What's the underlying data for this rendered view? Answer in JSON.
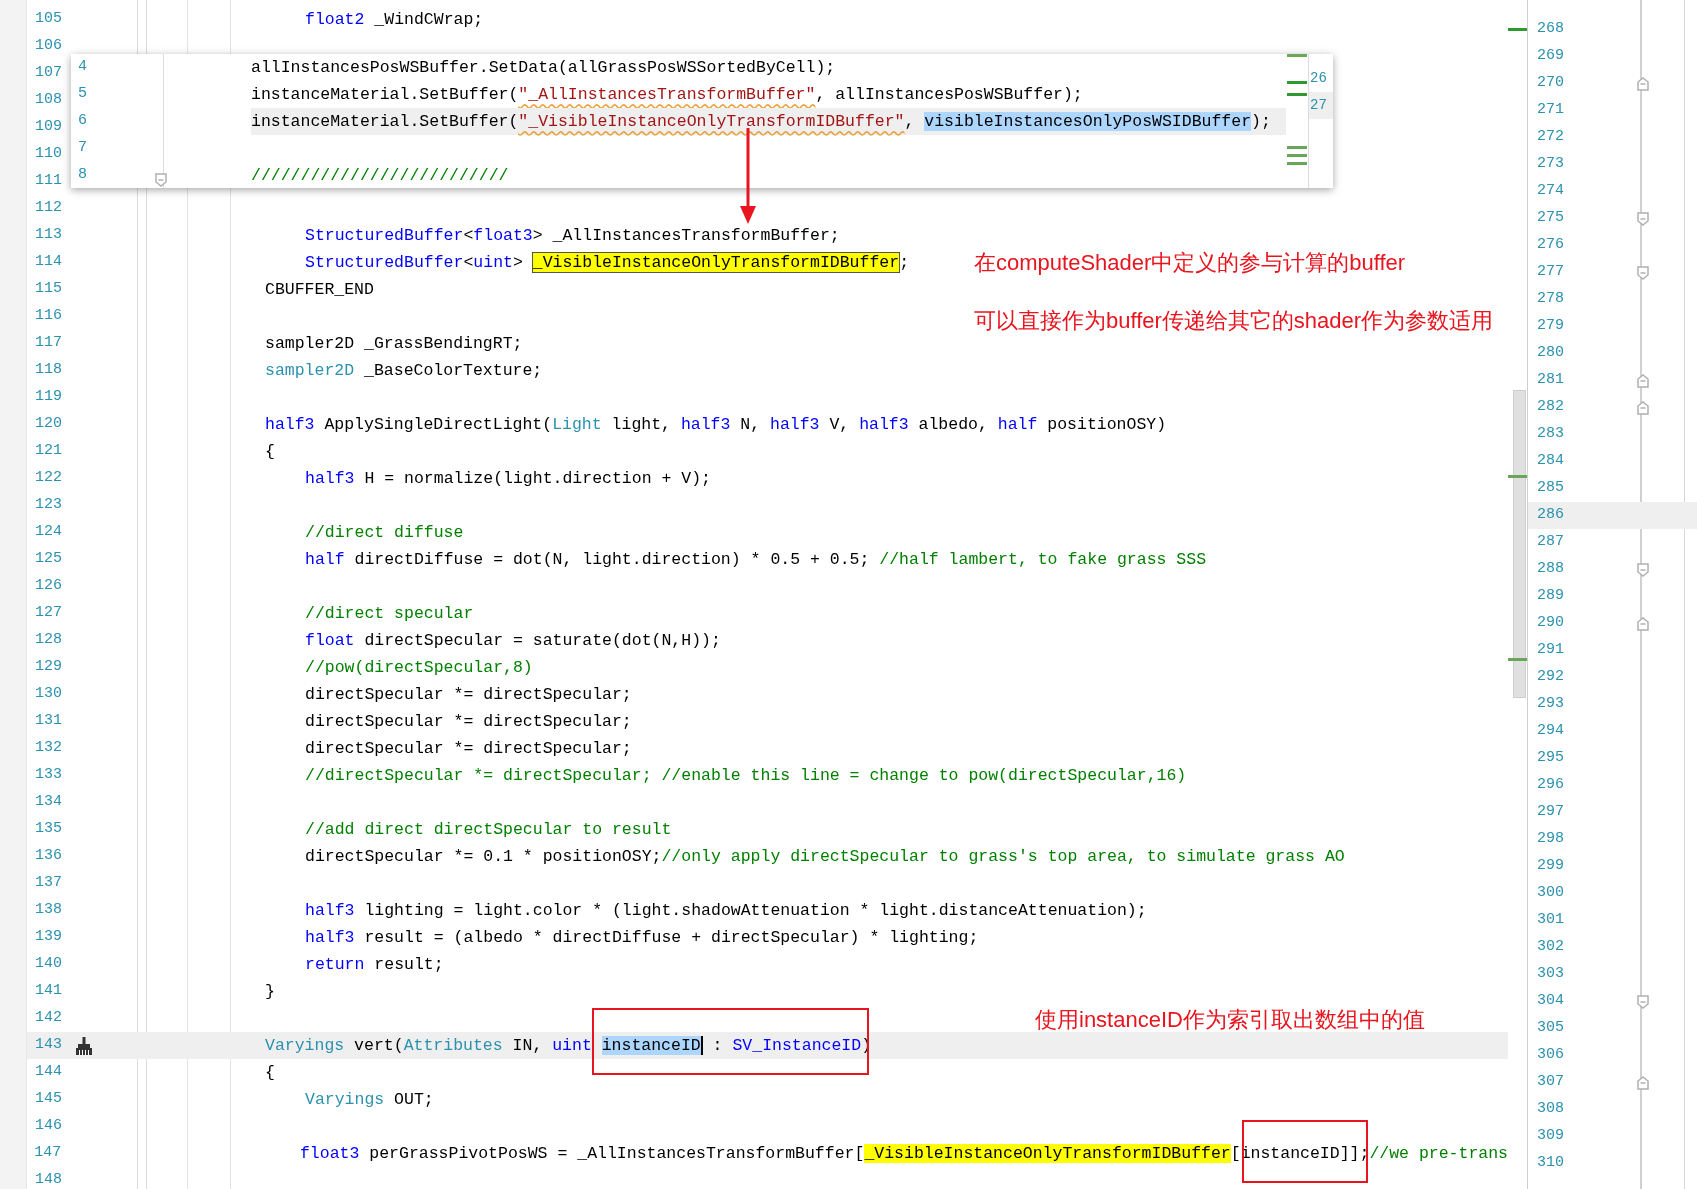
{
  "left_editor": {
    "lines": [
      {
        "number": "105",
        "current": false,
        "indented": true,
        "tokens": [
          {
            "kind": "keyword",
            "text": "float2"
          },
          {
            "kind": "plain",
            "text": " _WindCWrap;"
          }
        ]
      },
      {
        "number": "106",
        "current": false
      },
      {
        "number": "107",
        "current": false
      },
      {
        "number": "108",
        "current": false
      },
      {
        "number": "109",
        "current": false
      },
      {
        "number": "110",
        "current": false
      },
      {
        "number": "111",
        "current": false
      },
      {
        "number": "112",
        "current": false
      },
      {
        "number": "113",
        "current": false,
        "indented": true,
        "tokens": [
          {
            "kind": "keyword",
            "text": "StructuredBuffer"
          },
          {
            "kind": "plain",
            "text": "<"
          },
          {
            "kind": "keyword",
            "text": "float3"
          },
          {
            "kind": "plain",
            "text": "> _AllInstancesTransformBuffer;"
          }
        ]
      },
      {
        "number": "114",
        "current": false,
        "indented": true,
        "tokens": [
          {
            "kind": "keyword",
            "text": "StructuredBuffer"
          },
          {
            "kind": "plain",
            "text": "<"
          },
          {
            "kind": "keyword",
            "text": "uint"
          },
          {
            "kind": "plain",
            "text": ">"
          },
          {
            "kind": "highlight-outlined",
            "space_before": true,
            "text": "_VisibleInstanceOnlyTransformIDBuffer"
          },
          {
            "kind": "plain",
            "text": ";"
          }
        ]
      },
      {
        "number": "115",
        "current": false,
        "indented": false,
        "tokens": [
          {
            "kind": "plain",
            "text": "CBUFFER_END"
          }
        ]
      },
      {
        "number": "116",
        "current": false
      },
      {
        "number": "117",
        "current": false,
        "indented": false,
        "tokens": [
          {
            "kind": "plain",
            "text": "sampler2D _GrassBendingRT;"
          }
        ]
      },
      {
        "number": "118",
        "current": false,
        "indented": false,
        "tokens": [
          {
            "kind": "type",
            "text": "sampler2D"
          },
          {
            "kind": "plain",
            "text": " _BaseColorTexture;"
          }
        ]
      },
      {
        "number": "119",
        "current": false
      },
      {
        "number": "120",
        "current": false,
        "indented": false,
        "tokens": [
          {
            "kind": "keyword",
            "text": "half3"
          },
          {
            "kind": "plain",
            "text": " ApplySingleDirectLight("
          },
          {
            "kind": "type",
            "text": "Light"
          },
          {
            "kind": "plain",
            "text": " light, "
          },
          {
            "kind": "keyword",
            "text": "half3"
          },
          {
            "kind": "plain",
            "text": " N, "
          },
          {
            "kind": "keyword",
            "text": "half3"
          },
          {
            "kind": "plain",
            "text": " V, "
          },
          {
            "kind": "keyword",
            "text": "half3"
          },
          {
            "kind": "plain",
            "text": " albedo, "
          },
          {
            "kind": "keyword",
            "text": "half"
          },
          {
            "kind": "plain",
            "text": " positionOSY)"
          }
        ]
      },
      {
        "number": "121",
        "current": false,
        "indented": false,
        "tokens": [
          {
            "kind": "plain",
            "text": "{"
          }
        ]
      },
      {
        "number": "122",
        "current": false,
        "indented": true,
        "tokens": [
          {
            "kind": "keyword",
            "text": "half3"
          },
          {
            "kind": "plain",
            "text": " H = normalize(light.direction + V);"
          }
        ]
      },
      {
        "number": "123",
        "current": false
      },
      {
        "number": "124",
        "current": false,
        "indented": true,
        "tokens": [
          {
            "kind": "comment",
            "text": "//direct diffuse"
          }
        ]
      },
      {
        "number": "125",
        "current": false,
        "indented": true,
        "tokens": [
          {
            "kind": "keyword",
            "text": "half"
          },
          {
            "kind": "plain",
            "text": " directDiffuse = dot(N, light.direction) * 0.5 + 0.5; "
          },
          {
            "kind": "comment",
            "text": "//half lambert, to fake grass SSS"
          }
        ]
      },
      {
        "number": "126",
        "current": false
      },
      {
        "number": "127",
        "current": false,
        "indented": true,
        "tokens": [
          {
            "kind": "comment",
            "text": "//direct specular"
          }
        ]
      },
      {
        "number": "128",
        "current": false,
        "indented": true,
        "tokens": [
          {
            "kind": "keyword",
            "text": "float"
          },
          {
            "kind": "plain",
            "text": " directSpecular = saturate(dot(N,H));"
          }
        ]
      },
      {
        "number": "129",
        "current": false,
        "indented": true,
        "tokens": [
          {
            "kind": "comment",
            "text": "//pow(directSpecular,8)"
          }
        ]
      },
      {
        "number": "130",
        "current": false,
        "indented": true,
        "tokens": [
          {
            "kind": "plain",
            "text": "directSpecular *= directSpecular;"
          }
        ]
      },
      {
        "number": "131",
        "current": false,
        "indented": true,
        "tokens": [
          {
            "kind": "plain",
            "text": "directSpecular *= directSpecular;"
          }
        ]
      },
      {
        "number": "132",
        "current": false,
        "indented": true,
        "tokens": [
          {
            "kind": "plain",
            "text": "directSpecular *= directSpecular;"
          }
        ]
      },
      {
        "number": "133",
        "current": false,
        "indented": true,
        "tokens": [
          {
            "kind": "comment",
            "text": "//directSpecular *= directSpecular; //enable this line = change to pow(directSpecular,16)"
          }
        ]
      },
      {
        "number": "134",
        "current": false
      },
      {
        "number": "135",
        "current": false,
        "indented": true,
        "tokens": [
          {
            "kind": "comment",
            "text": "//add direct directSpecular to result"
          }
        ]
      },
      {
        "number": "136",
        "current": false,
        "indented": true,
        "tokens": [
          {
            "kind": "plain",
            "text": "directSpecular *= 0.1 * positionOSY;"
          },
          {
            "kind": "comment",
            "text": "//only apply directSpecular to grass's top area, to simulate grass AO"
          }
        ]
      },
      {
        "number": "137",
        "current": false
      },
      {
        "number": "138",
        "current": false,
        "indented": true,
        "tokens": [
          {
            "kind": "keyword",
            "text": "half3"
          },
          {
            "kind": "plain",
            "text": " lighting = light.color * (light.shadowAttenuation * light.distanceAttenuation);"
          }
        ]
      },
      {
        "number": "139",
        "current": false,
        "indented": true,
        "tokens": [
          {
            "kind": "keyword",
            "text": "half3"
          },
          {
            "kind": "plain",
            "text": " result = (albedo * directDiffuse + directSpecular) * lighting;"
          }
        ]
      },
      {
        "number": "140",
        "current": false,
        "indented": true,
        "tokens": [
          {
            "kind": "keyword",
            "text": "return"
          },
          {
            "kind": "plain",
            "text": " result;"
          }
        ]
      },
      {
        "number": "141",
        "current": false,
        "indented": false,
        "tokens": [
          {
            "kind": "plain",
            "text": "}"
          }
        ]
      },
      {
        "number": "142",
        "current": false
      },
      {
        "number": "143",
        "current": true,
        "indented": false,
        "tokens": [
          {
            "kind": "type",
            "text": "Varyings"
          },
          {
            "kind": "plain",
            "text": " vert("
          },
          {
            "kind": "type",
            "text": "Attributes"
          },
          {
            "kind": "plain",
            "text": " IN, "
          },
          {
            "kind": "keyword",
            "text": "uint"
          },
          {
            "kind": "selection",
            "space_before": true,
            "caret_after": true,
            "text": "instanceID"
          },
          {
            "kind": "plain",
            "text": " : "
          },
          {
            "kind": "keyword",
            "text": "SV_InstanceID"
          },
          {
            "kind": "plain",
            "text": ")"
          }
        ]
      },
      {
        "number": "144",
        "current": false,
        "indented": false,
        "tokens": [
          {
            "kind": "plain",
            "text": "{"
          }
        ]
      },
      {
        "number": "145",
        "current": false,
        "indented": true,
        "tokens": [
          {
            "kind": "type",
            "text": "Varyings"
          },
          {
            "kind": "plain",
            "text": " OUT;"
          }
        ]
      },
      {
        "number": "146",
        "current": false
      },
      {
        "number": "147",
        "current": false,
        "indented": true,
        "tokens": [
          {
            "kind": "keyword",
            "text": "float3"
          },
          {
            "kind": "plain",
            "text": " perGrassPivotPosWS = _AllInstancesTransformBuffer["
          },
          {
            "kind": "highlight",
            "text": "_VisibleInstanceOnlyTransformIDBuffer"
          },
          {
            "kind": "plain",
            "text": "[instanceID]];"
          },
          {
            "kind": "comment",
            "text": "//we pre-trans"
          }
        ]
      },
      {
        "number": "148",
        "current": false
      }
    ]
  },
  "peek_window": {
    "lines": [
      {
        "number": "4",
        "current": false,
        "collapsible": false,
        "tokens": [
          {
            "kind": "plain",
            "text": "allInstancesPosWSBuffer.SetData(allGrassPosWSSortedByCell);"
          }
        ]
      },
      {
        "number": "5",
        "current": false,
        "collapsible": false,
        "tokens": [
          {
            "kind": "plain",
            "text": "instanceMaterial.SetBuffer("
          },
          {
            "kind": "string",
            "squiggle": true,
            "text": "\"_AllInstancesTransformBuffer\""
          },
          {
            "kind": "plain",
            "text": ", allInstancesPosWSBuffer);"
          }
        ]
      },
      {
        "number": "6",
        "current": true,
        "collapsible": false,
        "tokens": [
          {
            "kind": "plain",
            "text": "instanceMaterial.SetBuffer("
          },
          {
            "kind": "string",
            "squiggle": true,
            "text": "\"_VisibleInstanceOnlyTransformIDBuffer\""
          },
          {
            "kind": "plain",
            "text": ","
          },
          {
            "kind": "selection",
            "space_before": true,
            "text": "visibleInstancesOnlyPosWSIDBuffer"
          },
          {
            "kind": "plain",
            "text": ");"
          }
        ]
      },
      {
        "number": "7",
        "current": false,
        "collapsible": false
      },
      {
        "number": "8",
        "current": false,
        "collapsible": true,
        "tokens": [
          {
            "kind": "comment",
            "text": "//////////////////////////"
          }
        ]
      }
    ],
    "side_numbers": [
      {
        "number": "26",
        "current": false
      },
      {
        "number": "27",
        "current": true
      }
    ]
  },
  "right_editor": {
    "lines": [
      {
        "number": "268",
        "current": false
      },
      {
        "number": "269",
        "current": false
      },
      {
        "number": "270",
        "current": false,
        "block_end": true
      },
      {
        "number": "271",
        "current": false
      },
      {
        "number": "272",
        "current": false
      },
      {
        "number": "273",
        "current": false
      },
      {
        "number": "274",
        "current": false
      },
      {
        "number": "275",
        "current": false,
        "collapsible": true
      },
      {
        "number": "276",
        "current": false
      },
      {
        "number": "277",
        "current": false,
        "collapsible": true
      },
      {
        "number": "278",
        "current": false
      },
      {
        "number": "279",
        "current": false
      },
      {
        "number": "280",
        "current": false
      },
      {
        "number": "281",
        "current": false,
        "block_end": true
      },
      {
        "number": "282",
        "current": false,
        "block_end": true
      },
      {
        "number": "283",
        "current": false
      },
      {
        "number": "284",
        "current": false
      },
      {
        "number": "285",
        "current": false
      },
      {
        "number": "286",
        "current": true
      },
      {
        "number": "287",
        "current": false
      },
      {
        "number": "288",
        "current": false,
        "collapsible": true
      },
      {
        "number": "289",
        "current": false
      },
      {
        "number": "290",
        "current": false,
        "block_end": true
      },
      {
        "number": "291",
        "current": false
      },
      {
        "number": "292",
        "current": false
      },
      {
        "number": "293",
        "current": false
      },
      {
        "number": "294",
        "current": false
      },
      {
        "number": "295",
        "current": false
      },
      {
        "number": "296",
        "current": false
      },
      {
        "number": "297",
        "current": false
      },
      {
        "number": "298",
        "current": false
      },
      {
        "number": "299",
        "current": false
      },
      {
        "number": "300",
        "current": false
      },
      {
        "number": "301",
        "current": false
      },
      {
        "number": "302",
        "current": false
      },
      {
        "number": "303",
        "current": false
      },
      {
        "number": "304",
        "current": false,
        "collapsible": true
      },
      {
        "number": "305",
        "current": false
      },
      {
        "number": "306",
        "current": false
      },
      {
        "number": "307",
        "current": false,
        "block_end": true
      },
      {
        "number": "308",
        "current": false
      },
      {
        "number": "309",
        "current": false
      },
      {
        "number": "310",
        "current": false
      }
    ]
  },
  "annotations": [
    {
      "text": "在computeShader中定义的参与计算的buffer"
    },
    {
      "text": "可以直接作为buffer传递给其它的shader作为参数适用"
    },
    {
      "text": "使用instanceID作为索引取出数组中的值"
    }
  ]
}
